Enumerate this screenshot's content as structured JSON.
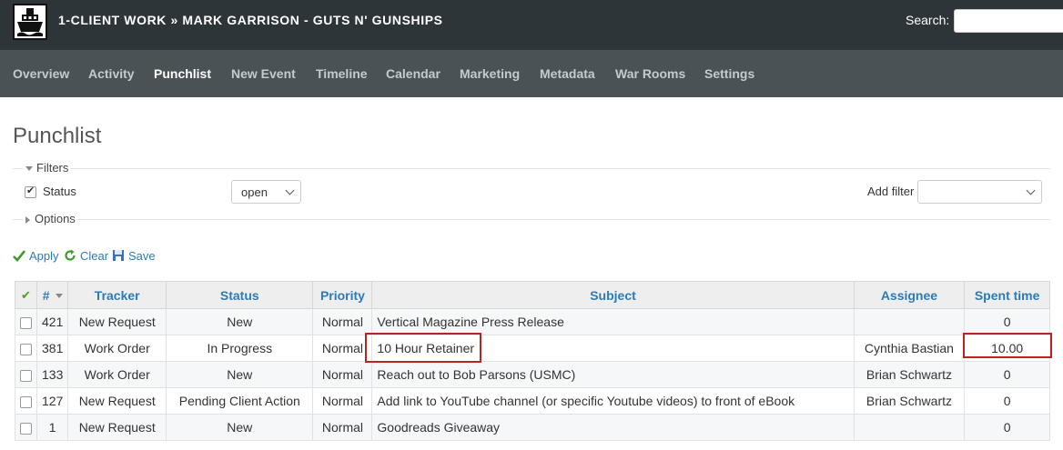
{
  "header": {
    "project_title": "1-CLIENT WORK » MARK GARRISON - GUTS N' GUNSHIPS",
    "search_label": "Search:",
    "search_value": ""
  },
  "nav": {
    "tabs": [
      {
        "label": "Overview"
      },
      {
        "label": "Activity"
      },
      {
        "label": "Punchlist",
        "selected": true
      },
      {
        "label": "New Event"
      },
      {
        "label": "Timeline"
      },
      {
        "label": "Calendar"
      },
      {
        "label": "Marketing"
      },
      {
        "label": "Metadata"
      },
      {
        "label": "War Rooms"
      },
      {
        "label": "Settings"
      }
    ]
  },
  "page": {
    "title": "Punchlist"
  },
  "filters": {
    "legend": "Filters",
    "status_label": "Status",
    "status_checked": true,
    "status_operator": "open",
    "add_filter_label": "Add filter",
    "add_filter_value": ""
  },
  "options": {
    "legend": "Options"
  },
  "actions": {
    "apply": "Apply",
    "clear": "Clear",
    "save": "Save"
  },
  "table": {
    "headers": {
      "id": "#",
      "tracker": "Tracker",
      "status": "Status",
      "priority": "Priority",
      "subject": "Subject",
      "assignee": "Assignee",
      "spent_time": "Spent time"
    },
    "rows": [
      {
        "id": "421",
        "tracker": "New Request",
        "status": "New",
        "priority": "Normal",
        "subject": "Vertical Magazine Press Release",
        "assignee": "",
        "spent_time": "0"
      },
      {
        "id": "381",
        "tracker": "Work Order",
        "status": "In Progress",
        "priority": "Normal",
        "subject": "10 Hour Retainer",
        "assignee": "Cynthia Bastian",
        "spent_time": "10.00"
      },
      {
        "id": "133",
        "tracker": "Work Order",
        "status": "New",
        "priority": "Normal",
        "subject": "Reach out to Bob Parsons (USMC)",
        "assignee": "Brian Schwartz",
        "spent_time": "0"
      },
      {
        "id": "127",
        "tracker": "New Request",
        "status": "Pending Client Action",
        "priority": "Normal",
        "subject": "Add link to YouTube channel (or specific Youtube videos) to front of eBook",
        "assignee": "Brian Schwartz",
        "spent_time": "0"
      },
      {
        "id": "1",
        "tracker": "New Request",
        "status": "New",
        "priority": "Normal",
        "subject": "Goodreads Giveaway",
        "assignee": "",
        "spent_time": "0"
      }
    ]
  },
  "colors": {
    "topbar": "#2e3538",
    "nav": "#4b5255",
    "link": "#2c7bb6",
    "highlight": "#b22222"
  }
}
